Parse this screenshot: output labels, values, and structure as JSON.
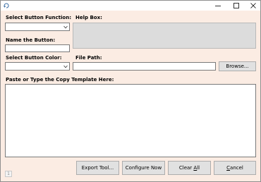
{
  "window": {
    "minimize_icon": "minimize-icon",
    "maximize_icon": "maximize-icon",
    "close_icon": "close-icon",
    "app_icon": "app-refresh-icon"
  },
  "form": {
    "select_function_label": "Select Button Function:",
    "help_box_label": "Help Box:",
    "name_button_label": "Name the Button:",
    "select_color_label": "Select Button Color:",
    "file_path_label": "File Path:",
    "copy_template_label": "Paste or Type the Copy Template Here:",
    "function_value": "",
    "name_value": "",
    "color_value": "",
    "file_path_value": "",
    "help_text": "",
    "template_text": ""
  },
  "buttons": {
    "browse": "Browse...",
    "export_tool": "Export Tool...",
    "configure_now": "Configure Now",
    "clear_all_prefix": "Clear ",
    "clear_all_mnemonic": "A",
    "clear_all_suffix": "ll",
    "cancel_mnemonic": "C",
    "cancel_suffix": "ancel"
  },
  "status": {
    "page_number": "1"
  },
  "colors": {
    "background": "#fbece3",
    "help_box": "#dcdcdc",
    "button_face": "#e1e1e1"
  }
}
